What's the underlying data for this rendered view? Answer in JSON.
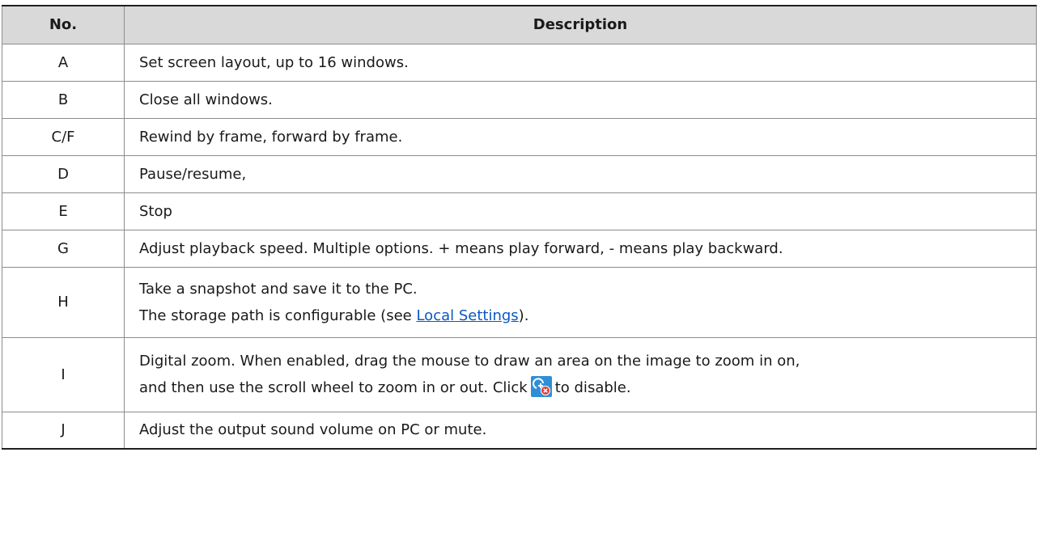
{
  "headers": {
    "no": "No.",
    "description": "Description"
  },
  "rows": [
    {
      "no": "A",
      "description": "Set screen layout, up to 16 windows."
    },
    {
      "no": "B",
      "description": "Close all windows."
    },
    {
      "no": "C/F",
      "description": "Rewind by frame, forward by frame."
    },
    {
      "no": "D",
      "description": "Pause/resume,"
    },
    {
      "no": "E",
      "description": "Stop"
    },
    {
      "no": "G",
      "description": "Adjust playback speed. Multiple options. + means play forward, - means play backward."
    },
    {
      "no": "H",
      "line1": "Take a snapshot and save it to the PC.",
      "line2_pre": "The storage path is configurable (see ",
      "line2_link": "Local Settings",
      "line2_post": ")."
    },
    {
      "no": "I",
      "line1": "Digital zoom. When enabled, drag the mouse to draw an area on the image to zoom in on,",
      "line2_pre": "and then use the scroll wheel to zoom in or out. Click",
      "line2_icon": "zoom-disable-icon",
      "line2_post": "to disable."
    },
    {
      "no": "J",
      "description": "Adjust the output sound volume on PC or mute."
    }
  ]
}
